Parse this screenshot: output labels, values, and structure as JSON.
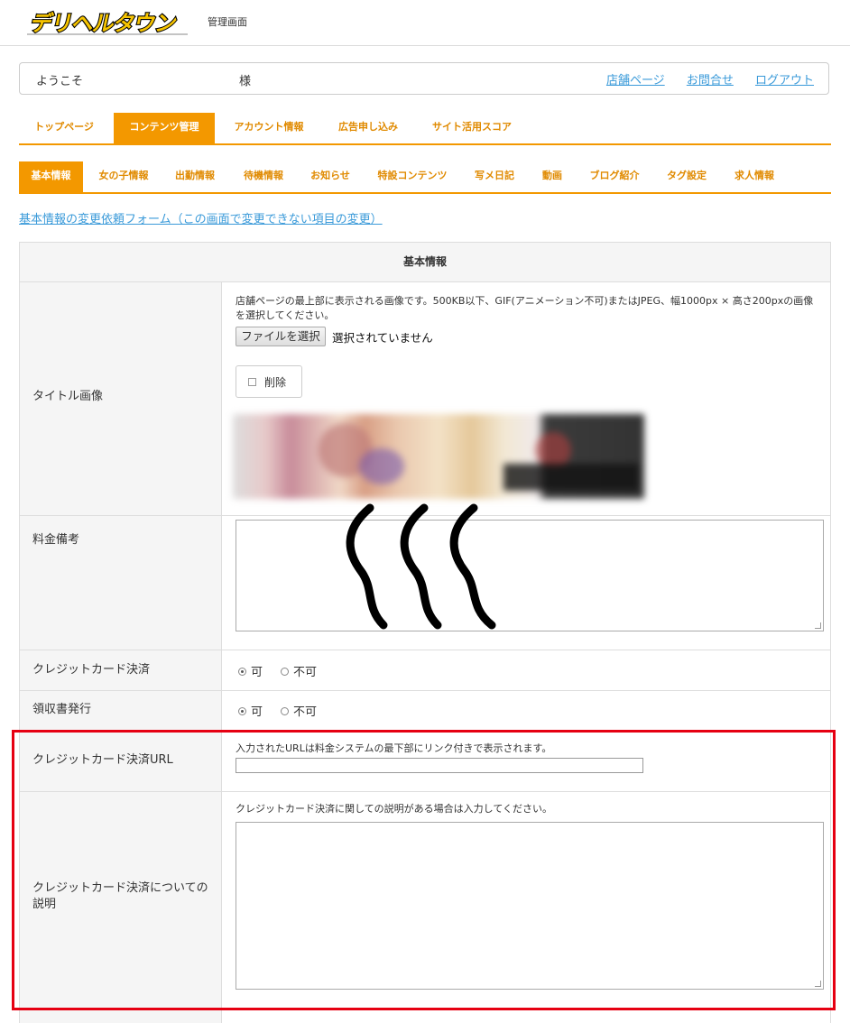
{
  "header": {
    "logo_text": "デリヘルタウン",
    "admin_label": "管理画面"
  },
  "welcome": {
    "greeting": "ようこそ",
    "honorific": "様",
    "links": [
      "店舗ページ",
      "お問合せ",
      "ログアウト"
    ]
  },
  "main_tabs": [
    "トップページ",
    "コンテンツ管理",
    "アカウント情報",
    "広告申し込み",
    "サイト活用スコア"
  ],
  "main_tab_active": 1,
  "sub_tabs": [
    "基本情報",
    "女の子情報",
    "出勤情報",
    "待機情報",
    "お知らせ",
    "特設コンテンツ",
    "写メ日記",
    "動画",
    "ブログ紹介",
    "タグ設定",
    "求人情報"
  ],
  "sub_tab_active": 0,
  "form_link": "基本情報の変更依頼フォーム（この画面で変更できない項目の変更）",
  "table": {
    "title": "基本情報",
    "title_image": {
      "label": "タイトル画像",
      "help": "店舗ページの最上部に表示される画像です。500KB以下、GIF(アニメーション不可)またはJPEG、幅1000px × 高さ200pxの画像を選択してください。",
      "file_button": "ファイルを選択",
      "file_status": "選択されていません",
      "delete_label": "削除"
    },
    "price_note": {
      "label": "料金備考"
    },
    "credit_card": {
      "label": "クレジットカード決済",
      "options": [
        "可",
        "不可"
      ],
      "selected": "可"
    },
    "receipt": {
      "label": "領収書発行",
      "options": [
        "可",
        "不可"
      ],
      "selected": "可"
    },
    "credit_url": {
      "label": "クレジットカード決済URL",
      "help": "入力されたURLは料金システムの最下部にリンク付きで表示されます。",
      "value": ""
    },
    "credit_description": {
      "label": "クレジットカード決済についての説明",
      "help": "クレジットカード決済に関しての説明がある場合は入力してください。",
      "value": ""
    }
  },
  "colors": {
    "accent": "#f39800",
    "link": "#3a9ad9",
    "highlight_box": "#e60012"
  }
}
